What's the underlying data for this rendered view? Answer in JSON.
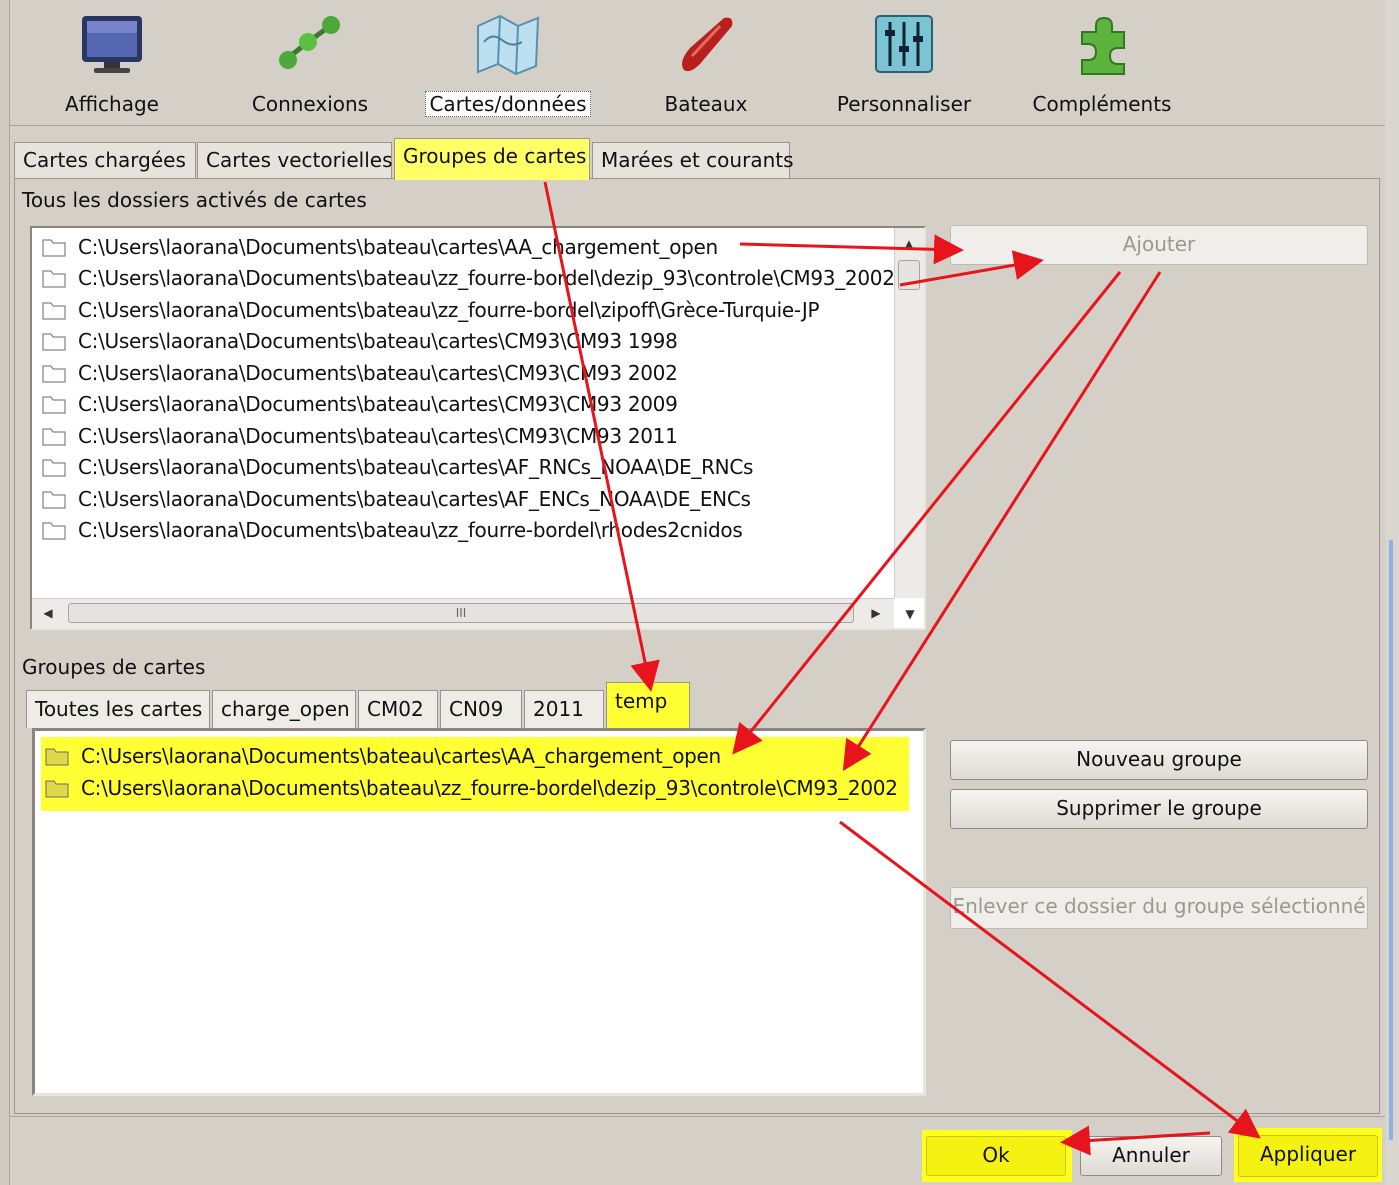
{
  "toolbar": {
    "items": [
      {
        "label": "Affichage",
        "icon": "monitor-icon"
      },
      {
        "label": "Connexions",
        "icon": "connections-icon"
      },
      {
        "label": "Cartes/données",
        "icon": "charts-icon"
      },
      {
        "label": "Bateaux",
        "icon": "boat-icon"
      },
      {
        "label": "Personnaliser",
        "icon": "sliders-icon"
      },
      {
        "label": "Compléments",
        "icon": "puzzle-icon"
      }
    ],
    "active": "Cartes/données"
  },
  "tabs": [
    "Cartes chargées",
    "Cartes vectorielles",
    "Groupes de cartes",
    "Marées et courants"
  ],
  "active_tab": "Groupes de cartes",
  "folders_section": {
    "caption": "Tous les dossiers activés de cartes",
    "items": [
      "C:\\Users\\laorana\\Documents\\bateau\\cartes\\AA_chargement_open",
      "C:\\Users\\laorana\\Documents\\bateau\\zz_fourre-bordel\\dezip_93\\controle\\CM93_2002",
      "C:\\Users\\laorana\\Documents\\bateau\\zz_fourre-bordel\\zipoff\\Grèce-Turquie-JP",
      "C:\\Users\\laorana\\Documents\\bateau\\cartes\\CM93\\CM93 1998",
      "C:\\Users\\laorana\\Documents\\bateau\\cartes\\CM93\\CM93 2002",
      "C:\\Users\\laorana\\Documents\\bateau\\cartes\\CM93\\CM93 2009",
      "C:\\Users\\laorana\\Documents\\bateau\\cartes\\CM93\\CM93 2011",
      "C:\\Users\\laorana\\Documents\\bateau\\cartes\\AF_RNCs_NOAA\\DE_RNCs",
      "C:\\Users\\laorana\\Documents\\bateau\\cartes\\AF_ENCs_NOAA\\DE_ENCs",
      "C:\\Users\\laorana\\Documents\\bateau\\zz_fourre-bordel\\rhodes2cnidos"
    ],
    "scroll_thumb_text": "III"
  },
  "buttons": {
    "add": "Ajouter",
    "new_group": "Nouveau groupe",
    "delete_group": "Supprimer le groupe",
    "remove_folder": "Enlever ce dossier du groupe sélectionné",
    "ok": "Ok",
    "cancel": "Annuler",
    "apply": "Appliquer"
  },
  "groups_section": {
    "caption": "Groupes de cartes",
    "tabs": [
      "Toutes les cartes",
      "charge_open",
      "CM02",
      "CN09",
      "2011",
      "temp"
    ],
    "active_tab": "temp",
    "items": [
      "C:\\Users\\laorana\\Documents\\bateau\\cartes\\AA_chargement_open",
      "C:\\Users\\laorana\\Documents\\bateau\\zz_fourre-bordel\\dezip_93\\controle\\CM93_2002"
    ]
  },
  "colors": {
    "highlight": "#ffff33",
    "arrow": "#e8141c",
    "background": "#d4d0c8"
  }
}
